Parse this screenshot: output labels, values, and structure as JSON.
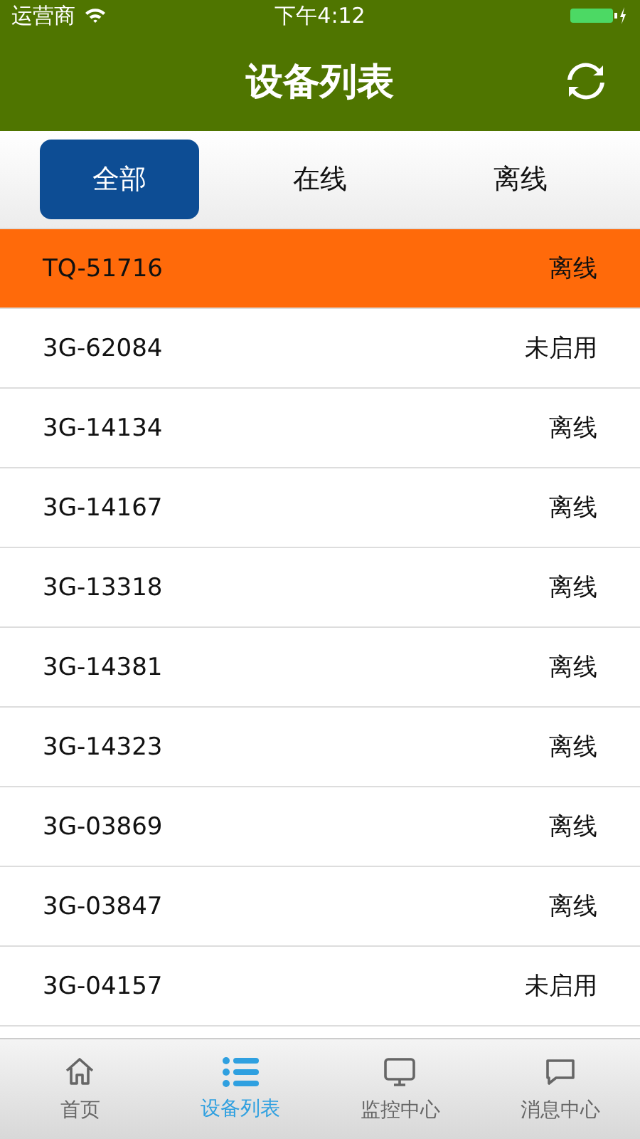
{
  "status_bar": {
    "carrier": "运营商",
    "time": "下午4:12",
    "charging": true
  },
  "header": {
    "title": "设备列表"
  },
  "tabs": [
    {
      "label": "全部",
      "selected": true
    },
    {
      "label": "在线",
      "selected": false
    },
    {
      "label": "离线",
      "selected": false
    }
  ],
  "devices": [
    {
      "name": "TQ-51716",
      "status": "离线",
      "selected": true
    },
    {
      "name": "3G-62084",
      "status": "未启用",
      "selected": false
    },
    {
      "name": "3G-14134",
      "status": "离线",
      "selected": false
    },
    {
      "name": "3G-14167",
      "status": "离线",
      "selected": false
    },
    {
      "name": "3G-13318",
      "status": "离线",
      "selected": false
    },
    {
      "name": "3G-14381",
      "status": "离线",
      "selected": false
    },
    {
      "name": "3G-14323",
      "status": "离线",
      "selected": false
    },
    {
      "name": "3G-03869",
      "status": "离线",
      "selected": false
    },
    {
      "name": "3G-03847",
      "status": "离线",
      "selected": false
    },
    {
      "name": "3G-04157",
      "status": "未启用",
      "selected": false
    }
  ],
  "bottom_nav": [
    {
      "label": "首页",
      "kind": "home",
      "selected": false
    },
    {
      "label": "设备列表",
      "kind": "list",
      "selected": true
    },
    {
      "label": "监控中心",
      "kind": "monitor",
      "selected": false
    },
    {
      "label": "消息中心",
      "kind": "message",
      "selected": false
    }
  ]
}
